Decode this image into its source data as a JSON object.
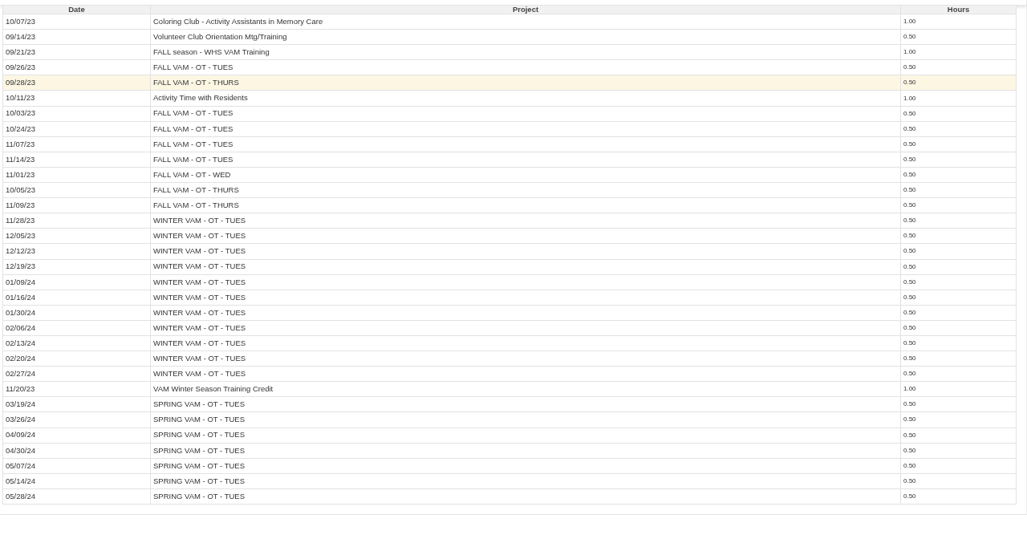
{
  "table": {
    "columns": [
      "Date",
      "Project",
      "Hours"
    ],
    "rows": [
      {
        "date": "10/07/23",
        "project": "Coloring Club - Activity Assistants in Memory Care",
        "hours": "1.00",
        "selected": false
      },
      {
        "date": "09/14/23",
        "project": "Volunteer Club Orientation Mtg/Training",
        "hours": "0.50",
        "selected": false
      },
      {
        "date": "09/21/23",
        "project": "FALL season - WHS VAM Training",
        "hours": "1.00",
        "selected": false
      },
      {
        "date": "09/26/23",
        "project": "FALL VAM - OT - TUES",
        "hours": "0.50",
        "selected": false
      },
      {
        "date": "09/28/23",
        "project": "FALL VAM - OT - THURS",
        "hours": "0.50",
        "selected": true
      },
      {
        "date": "10/11/23",
        "project": "Activity Time with Residents",
        "hours": "1.00",
        "selected": false
      },
      {
        "date": "10/03/23",
        "project": "FALL VAM - OT - TUES",
        "hours": "0.50",
        "selected": false
      },
      {
        "date": "10/24/23",
        "project": "FALL VAM - OT - TUES",
        "hours": "0.50",
        "selected": false
      },
      {
        "date": "11/07/23",
        "project": "FALL VAM - OT - TUES",
        "hours": "0.50",
        "selected": false
      },
      {
        "date": "11/14/23",
        "project": "FALL VAM - OT - TUES",
        "hours": "0.50",
        "selected": false
      },
      {
        "date": "11/01/23",
        "project": "FALL VAM - OT - WED",
        "hours": "0.50",
        "selected": false
      },
      {
        "date": "10/05/23",
        "project": "FALL VAM - OT - THURS",
        "hours": "0.50",
        "selected": false
      },
      {
        "date": "11/09/23",
        "project": "FALL VAM - OT - THURS",
        "hours": "0.50",
        "selected": false
      },
      {
        "date": "11/28/23",
        "project": "WINTER VAM - OT - TUES",
        "hours": "0.50",
        "selected": false
      },
      {
        "date": "12/05/23",
        "project": "WINTER VAM - OT - TUES",
        "hours": "0.50",
        "selected": false
      },
      {
        "date": "12/12/23",
        "project": "WINTER VAM - OT - TUES",
        "hours": "0.50",
        "selected": false
      },
      {
        "date": "12/19/23",
        "project": "WINTER VAM - OT - TUES",
        "hours": "0.50",
        "selected": false
      },
      {
        "date": "01/09/24",
        "project": "WINTER VAM - OT - TUES",
        "hours": "0.50",
        "selected": false
      },
      {
        "date": "01/16/24",
        "project": "WINTER VAM - OT - TUES",
        "hours": "0.50",
        "selected": false
      },
      {
        "date": "01/30/24",
        "project": "WINTER VAM - OT - TUES",
        "hours": "0.50",
        "selected": false
      },
      {
        "date": "02/06/24",
        "project": "WINTER VAM - OT - TUES",
        "hours": "0.50",
        "selected": false
      },
      {
        "date": "02/13/24",
        "project": "WINTER VAM - OT - TUES",
        "hours": "0.50",
        "selected": false
      },
      {
        "date": "02/20/24",
        "project": "WINTER VAM - OT - TUES",
        "hours": "0.50",
        "selected": false
      },
      {
        "date": "02/27/24",
        "project": "WINTER VAM - OT - TUES",
        "hours": "0.50",
        "selected": false
      },
      {
        "date": "11/20/23",
        "project": "VAM Winter Season Training Credit",
        "hours": "1.00",
        "selected": false
      },
      {
        "date": "03/19/24",
        "project": "SPRING VAM - OT - TUES",
        "hours": "0.50",
        "selected": false
      },
      {
        "date": "03/26/24",
        "project": "SPRING VAM - OT - TUES",
        "hours": "0.50",
        "selected": false
      },
      {
        "date": "04/09/24",
        "project": "SPRING VAM - OT - TUES",
        "hours": "0.50",
        "selected": false
      },
      {
        "date": "04/30/24",
        "project": "SPRING VAM - OT - TUES",
        "hours": "0.50",
        "selected": false
      },
      {
        "date": "05/07/24",
        "project": "SPRING VAM - OT - TUES",
        "hours": "0.50",
        "selected": false
      },
      {
        "date": "05/14/24",
        "project": "SPRING VAM - OT - TUES",
        "hours": "0.50",
        "selected": false
      },
      {
        "date": "05/28/24",
        "project": "SPRING VAM - OT - TUES",
        "hours": "0.50",
        "selected": false
      }
    ]
  }
}
